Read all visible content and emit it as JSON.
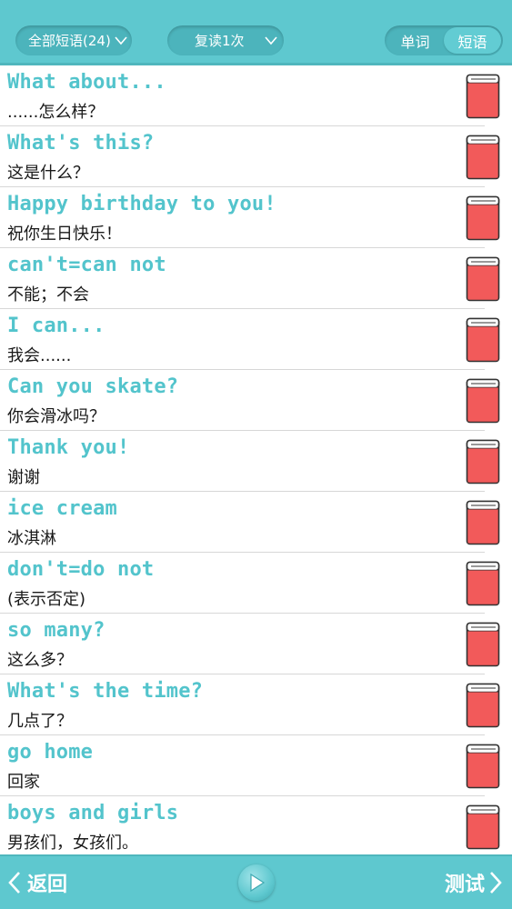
{
  "header": {
    "filter_label": "全部短语(24)",
    "repeat_label": "复读1次",
    "tabs": [
      {
        "label": "单词",
        "active": false
      },
      {
        "label": "短语",
        "active": true
      }
    ]
  },
  "phrases": [
    {
      "en": "What about...",
      "cn": "......怎么样？"
    },
    {
      "en": "What's  this?",
      "cn": "这是什么？"
    },
    {
      "en": "Happy birthday to you!",
      "cn": "祝你生日快乐！"
    },
    {
      "en": "can't=can not",
      "cn": "不能；不会"
    },
    {
      "en": "I can...",
      "cn": "我会......"
    },
    {
      "en": "Can you skate?",
      "cn": "你会滑冰吗？"
    },
    {
      "en": "Thank you!",
      "cn": "谢谢"
    },
    {
      "en": "ice cream",
      "cn": "冰淇淋"
    },
    {
      "en": "don't=do not",
      "cn": "(表示否定)"
    },
    {
      "en": "so many?",
      "cn": "这么多？"
    },
    {
      "en": "What's the time?",
      "cn": "几点了？"
    },
    {
      "en": "go home",
      "cn": "回家"
    },
    {
      "en": "boys and girls",
      "cn": "男孩们，女孩们。"
    }
  ],
  "footer": {
    "back_label": "返回",
    "test_label": "测试",
    "play_icon": "play-icon"
  },
  "colors": {
    "accent": "#5ec8cf",
    "phrase_text": "#53c4cc",
    "book_cover": "#f25a5a"
  }
}
